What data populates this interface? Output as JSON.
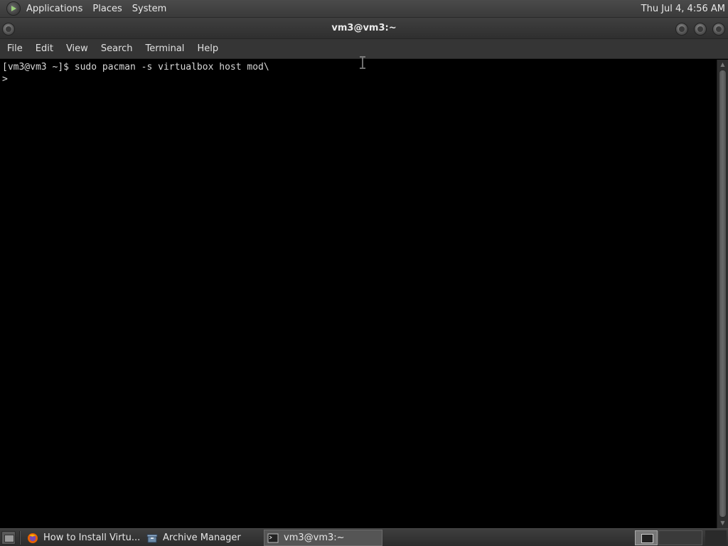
{
  "top_panel": {
    "menus": [
      "Applications",
      "Places",
      "System"
    ],
    "clock": "Thu Jul  4,  4:56 AM"
  },
  "window": {
    "title": "vm3@vm3:~",
    "menubar": [
      "File",
      "Edit",
      "View",
      "Search",
      "Terminal",
      "Help"
    ]
  },
  "terminal": {
    "lines": [
      "[vm3@vm3 ~]$ sudo pacman -s virtualbox host mod\\",
      ">"
    ]
  },
  "taskbar": {
    "tasks": [
      {
        "label": "How to Install Virtu...",
        "icon": "firefox-icon",
        "active": false
      },
      {
        "label": "Archive Manager",
        "icon": "archive-manager-icon",
        "active": false
      },
      {
        "label": "vm3@vm3:~",
        "icon": "terminal-icon",
        "active": true
      }
    ]
  },
  "colors": {
    "terminal_bg": "#000000",
    "terminal_fg": "#d8d8d8",
    "panel_bg": "#3a3a3a"
  }
}
